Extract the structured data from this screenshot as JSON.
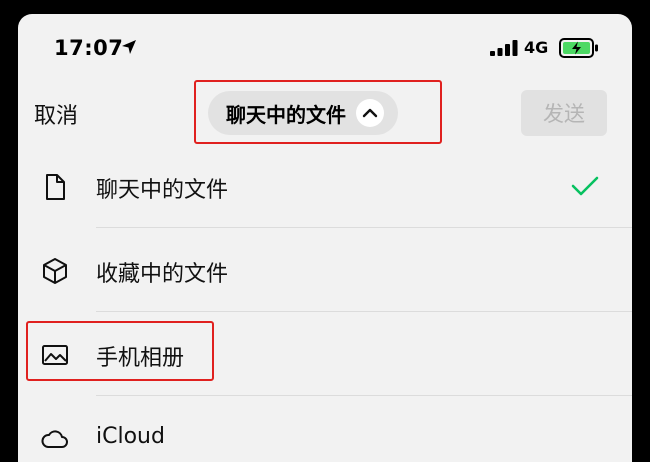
{
  "status_bar": {
    "time": "17:07",
    "network": "4G",
    "icons": [
      "location-arrow-icon",
      "signal-bars-icon",
      "battery-charging-icon"
    ]
  },
  "nav": {
    "cancel_label": "取消",
    "title": "聊天中的文件",
    "title_chevron": "chevron-up-icon",
    "send_label": "发送"
  },
  "list": {
    "items": [
      {
        "label": "聊天中的文件",
        "icon": "document-icon",
        "selected": true
      },
      {
        "label": "收藏中的文件",
        "icon": "cube-icon",
        "selected": false
      },
      {
        "label": "手机相册",
        "icon": "photo-icon",
        "selected": false
      },
      {
        "label": "iCloud",
        "icon": "cloud-icon",
        "selected": false
      }
    ]
  },
  "colors": {
    "background": "#f2f2f2",
    "check": "#07c160",
    "highlight": "#e0211f",
    "battery": "#4cd964",
    "send_disabled_bg": "#e1e1e1",
    "send_disabled_text": "#b5b5b5"
  }
}
